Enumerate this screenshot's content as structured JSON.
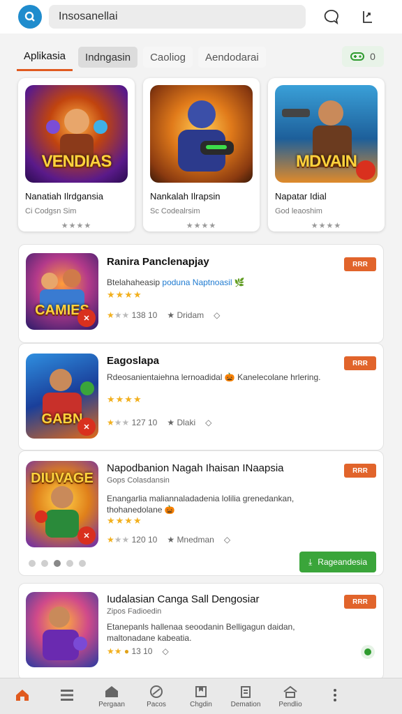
{
  "header": {
    "search_text": "Insosanellai",
    "icons": [
      "app-logo",
      "chat-icon",
      "share-icon"
    ]
  },
  "tabs": [
    {
      "label": "Aplikasia",
      "active": true
    },
    {
      "label": "Indngasin"
    },
    {
      "label": "Caoliog"
    },
    {
      "label": "Aendodarai"
    }
  ],
  "filter": {
    "count": "0"
  },
  "featured": [
    {
      "art_text": "VENDIAS",
      "title": "Nanatiah Ilrdgansia",
      "subtitle": "Ci Codgsn Sim",
      "stars": "★★★★"
    },
    {
      "art_text": "",
      "title": "Nankalah Ilrapsin",
      "subtitle": "Sc Codealrsim",
      "stars": "★★★★"
    },
    {
      "art_text": "MDVAIN",
      "title": "Napatar Idial",
      "subtitle": "God leaoshim",
      "stars": "★★★★"
    }
  ],
  "list": [
    {
      "art_text": "CAMIES",
      "title": "Ranira Panclenapjay",
      "desc": "Btelahaheasip",
      "desc_highlight": "poduna Naptnoasil",
      "stars": "★★★★",
      "meta_rating": "138 10",
      "meta_label": "Dridam",
      "tag": "RRR"
    },
    {
      "art_text": "GABN",
      "title": "Eagoslapa",
      "desc": "Rdeosanientaiehna lernoadidal 🎃 Kanelecolane hrlering.",
      "stars": "★★★★",
      "meta_rating": "127 10",
      "meta_label": "Dlaki",
      "tag": "RRR"
    },
    {
      "art_text": "DIUVAGE",
      "title": "Napodbanion Nagah Ihaisan INaapsia",
      "subtitle": "Gops Colasdansin",
      "desc": "Enangarlia maliannaladadenia lolilia grenedankan, thohanedolane 🎃",
      "stars": "★★★★",
      "meta_rating": "120 10",
      "meta_label": "Mnedman",
      "tag": "RRR",
      "install_label": "Rageandesia"
    },
    {
      "art_text": "",
      "title": "Iudalasian Canga Sall Dengosiar",
      "subtitle": "Zipos Fadioedin",
      "desc": "Etanepanls hallenaa seoodanin Belligagun daidan, maltonadane kabeatia.",
      "stars": "★★",
      "meta_rating": "13 10",
      "tag": "RRR"
    }
  ],
  "carousel": {
    "count": 5,
    "active": 2
  },
  "bottom_nav": [
    {
      "label": "",
      "icon": "home-icon"
    },
    {
      "label": "",
      "icon": "menu-icon"
    },
    {
      "label": "Pergaan",
      "icon": "store-icon"
    },
    {
      "label": "Pacos",
      "icon": "games-icon"
    },
    {
      "label": "Chgdin",
      "icon": "bookmark-icon"
    },
    {
      "label": "Demation",
      "icon": "library-icon"
    },
    {
      "label": "Pendlio",
      "icon": "profile-icon"
    },
    {
      "label": "",
      "icon": "more-icon"
    }
  ],
  "colors": {
    "accent": "#e05a1f",
    "tag": "#e1642b",
    "install": "#3aa53a",
    "logo": "#1f8ccd"
  }
}
